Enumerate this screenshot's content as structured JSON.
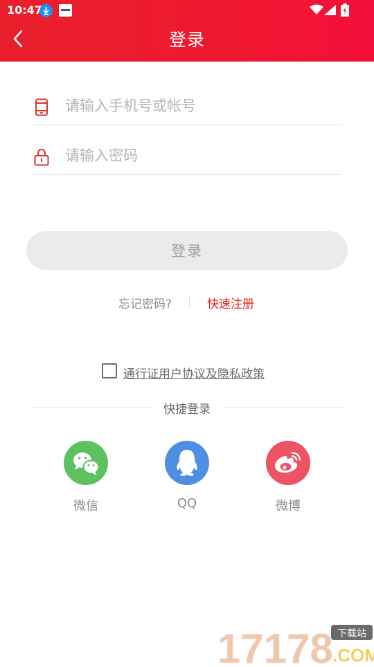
{
  "status_bar": {
    "time": "10:47"
  },
  "header": {
    "title": "登录"
  },
  "form": {
    "account_placeholder": "请输入手机号或帐号",
    "password_placeholder": "请输入密码",
    "login_label": "登录"
  },
  "links": {
    "forgot": "忘记密码?",
    "register": "快速注册"
  },
  "agreement": {
    "label": "通行证用户协议及隐私政策",
    "checked": false
  },
  "quick_login": {
    "title": "快捷登录",
    "options": [
      {
        "label": "微信",
        "icon": "wechat-icon",
        "color": "#5ec15f"
      },
      {
        "label": "QQ",
        "icon": "qq-icon",
        "color": "#4f8fe3"
      },
      {
        "label": "微博",
        "icon": "weibo-icon",
        "color": "#ee5265"
      }
    ]
  },
  "watermark": {
    "number": "17178",
    "domain": ".COM",
    "badge": "下载站"
  },
  "colors": {
    "brand": "#ea1f2b",
    "link": "#e3211f",
    "icon": "#d4362a"
  }
}
